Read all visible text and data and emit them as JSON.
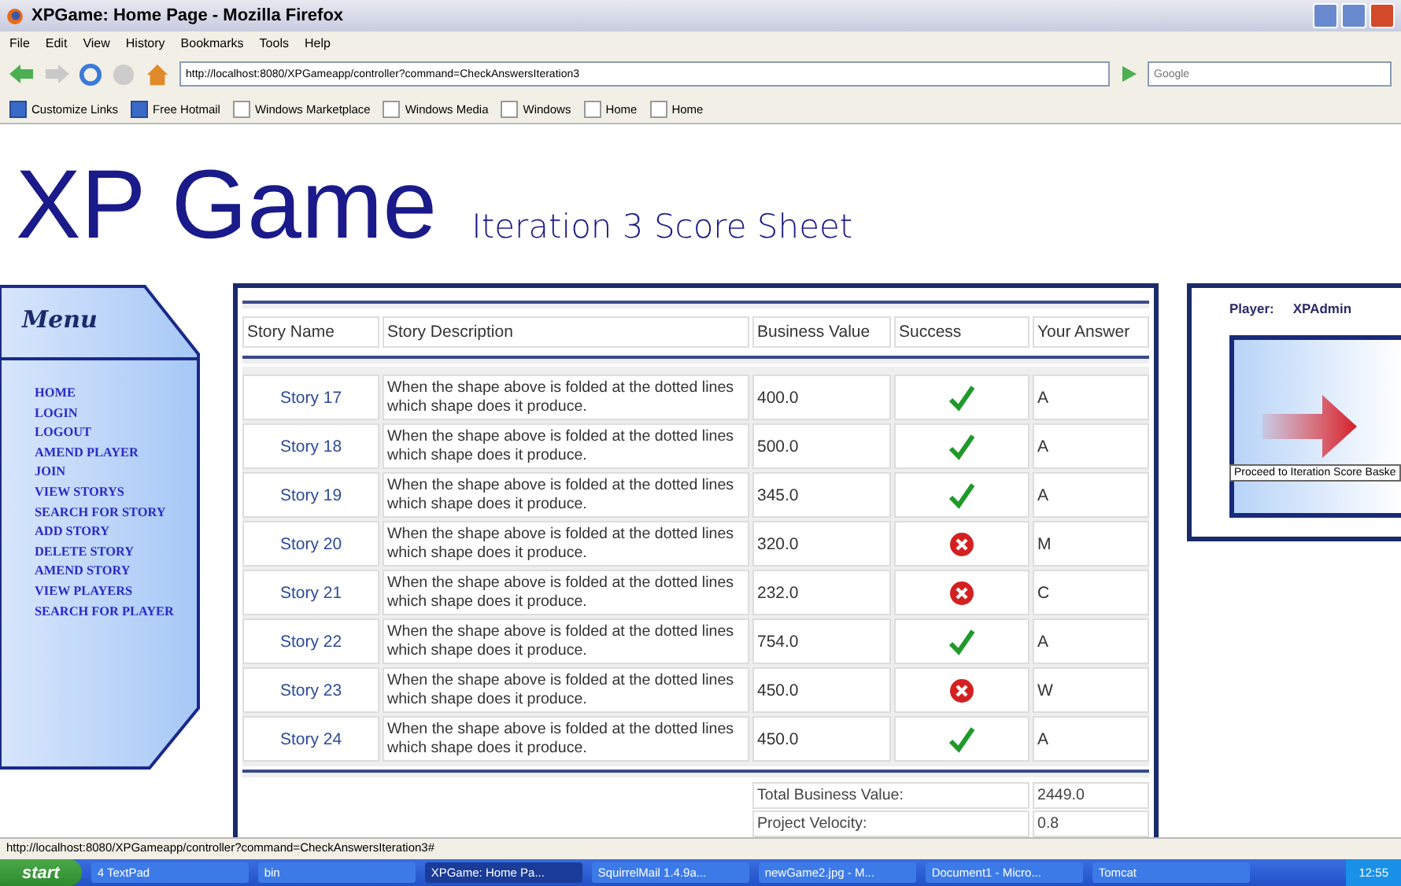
{
  "window": {
    "title": "XPGame: Home Page - Mozilla Firefox"
  },
  "menu_bar": [
    "File",
    "Edit",
    "View",
    "History",
    "Bookmarks",
    "Tools",
    "Help"
  ],
  "address_bar": {
    "value": "http://localhost:8080/XPGameapp/controller?command=CheckAnswersIteration3"
  },
  "search": {
    "placeholder": "Google"
  },
  "bookmarks": [
    "Customize Links",
    "Free Hotmail",
    "Windows Marketplace",
    "Windows Media",
    "Windows",
    "Home",
    "Home"
  ],
  "page": {
    "logo": "XP Game",
    "subtitle": "Iteration 3 Score Sheet"
  },
  "sidebar": {
    "title": "Menu",
    "items": [
      "HOME",
      "LOGIN",
      "LOGOUT",
      "AMEND PLAYER",
      "JOIN",
      "VIEW STORYS",
      "SEARCH FOR STORY",
      "ADD STORY",
      "DELETE STORY",
      "AMEND STORY",
      "VIEW PLAYERS",
      "SEARCH FOR PLAYER"
    ]
  },
  "table": {
    "columns": [
      "Story Name",
      "Story Description",
      "Business Value",
      "Success",
      "Your Answer"
    ],
    "rows": [
      {
        "name": "Story 17",
        "description": "When the shape above is folded at the dotted lines which shape does it produce.",
        "value": "400.0",
        "success": true,
        "answer": "A"
      },
      {
        "name": "Story 18",
        "description": "When the shape above is folded at the dotted lines which shape does it produce.",
        "value": "500.0",
        "success": true,
        "answer": "A"
      },
      {
        "name": "Story 19",
        "description": "When the shape above is folded at the dotted lines which shape does it produce.",
        "value": "345.0",
        "success": true,
        "answer": "A"
      },
      {
        "name": "Story 20",
        "description": "When the shape above is folded at the dotted lines which shape does it produce.",
        "value": "320.0",
        "success": false,
        "answer": "M"
      },
      {
        "name": "Story 21",
        "description": "When the shape above is folded at the dotted lines which shape does it produce.",
        "value": "232.0",
        "success": false,
        "answer": "C"
      },
      {
        "name": "Story 22",
        "description": "When the shape above is folded at the dotted lines which shape does it produce.",
        "value": "754.0",
        "success": true,
        "answer": "A"
      },
      {
        "name": "Story 23",
        "description": "When the shape above is folded at the dotted lines which shape does it produce.",
        "value": "450.0",
        "success": false,
        "answer": "W"
      },
      {
        "name": "Story 24",
        "description": "When the shape above is folded at the dotted lines which shape does it produce.",
        "value": "450.0",
        "success": true,
        "answer": "A"
      }
    ],
    "totals": [
      {
        "label": "Total Business Value:",
        "value": "2449.0"
      },
      {
        "label": "Project Velocity:",
        "value": "0.8"
      }
    ]
  },
  "player_panel": {
    "label": "Player:",
    "name": "XPAdmin",
    "tooltip": "Proceed to Iteration Score Baske"
  },
  "status_bar": "http://localhost:8080/XPGameapp/controller?command=CheckAnswersIteration3#",
  "taskbar": {
    "start": "start",
    "items": [
      {
        "label": "4 TextPad",
        "selected": false
      },
      {
        "label": "bin",
        "selected": false
      },
      {
        "label": "XPGame: Home Pa...",
        "selected": true
      },
      {
        "label": "SquirrelMail 1.4.9a...",
        "selected": false
      },
      {
        "label": "newGame2.jpg - M...",
        "selected": false
      },
      {
        "label": "Document1 - Micro...",
        "selected": false
      },
      {
        "label": "Tomcat",
        "selected": false
      }
    ],
    "clock": "12:55"
  }
}
